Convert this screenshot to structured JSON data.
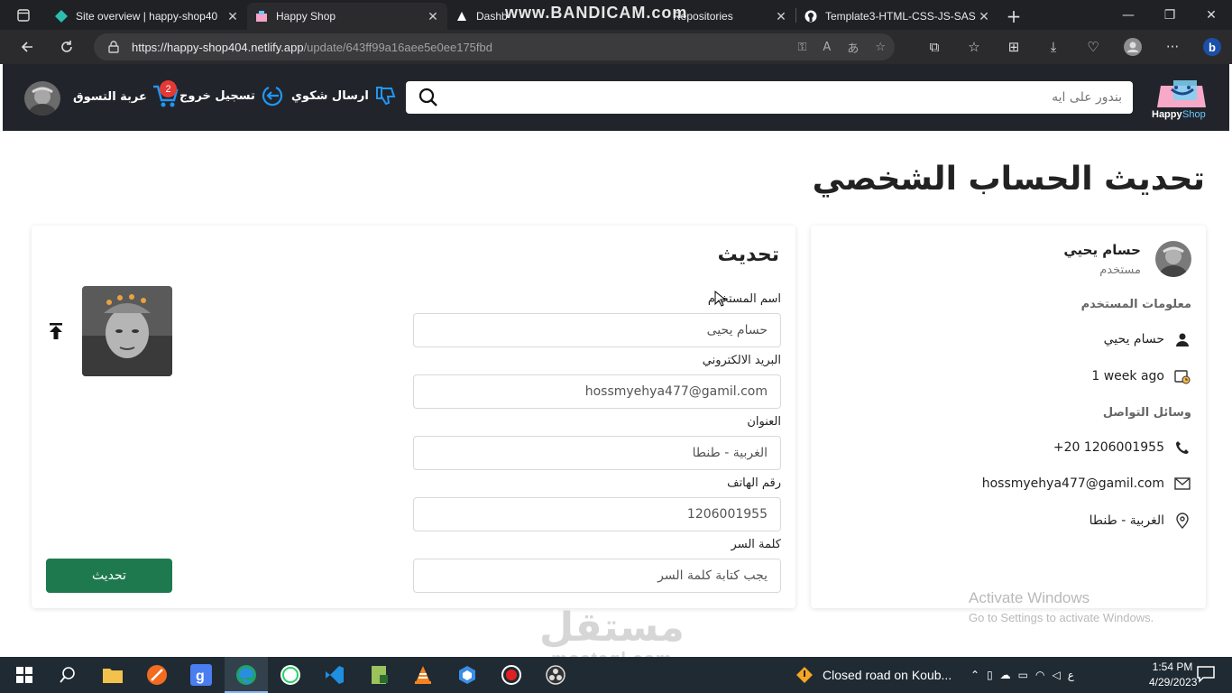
{
  "browser": {
    "tabs": [
      {
        "title": "Site overview | happy-shop40",
        "active": false
      },
      {
        "title": "Happy Shop",
        "active": true
      },
      {
        "title": "Dashb",
        "active": false
      },
      {
        "title": "Repositories",
        "active": false
      },
      {
        "title": "Template3-HTML-CSS-JS-SAS",
        "active": false
      }
    ],
    "recorder_watermark": "www.BANDICAM.com",
    "url_host": "https://happy-shop404.netlify.app",
    "url_path": "/update/643ff99a16aee5e0ee175fbd"
  },
  "navbar": {
    "logo_text_1": "Happy",
    "logo_text_2": "Shop",
    "search_placeholder": "بندور على ايه",
    "complaint_label": "ارسال شكوي",
    "logout_label": "تسجيل خروج",
    "cart_label": "عربة التسوق",
    "cart_count": "2"
  },
  "page": {
    "title": "تحديث الحساب الشخصي"
  },
  "profile": {
    "name": "حسام يحيي",
    "role": "مستخدم",
    "user_info_heading": "معلومات المستخدم",
    "username": "حسام يحيي",
    "joined": "1 week ago",
    "contact_heading": "وسائل التواصل",
    "phone": "+20 1206001955",
    "email": "hossmyehya477@gamil.com",
    "address": "الغربية - طنطا"
  },
  "form": {
    "title": "تحديث",
    "name_label": "اسم المستخدم",
    "name_value": "حسام يحيى",
    "email_label": "البريد الالكتروني",
    "email_value": "hossmyehya477@gamil.com",
    "address_label": "العنوان",
    "address_value": "الغربية - طنطا",
    "phone_label": "رقم الهاتف",
    "phone_value": "1206001955",
    "password_label": "كلمة السر",
    "password_placeholder": "يجب كتابة كلمة السر",
    "submit_label": "تحديث"
  },
  "overlay": {
    "activate_line1": "Activate Windows",
    "activate_line2": "Go to Settings to activate Windows.",
    "watermark_ar": "مستقل",
    "watermark_en": "mostaql.com"
  },
  "taskbar": {
    "notification": "Closed road on Koub...",
    "lang": "ع",
    "time": "1:54 PM",
    "date": "4/29/2023"
  },
  "colors": {
    "navbar_bg": "#21252b",
    "accent_blue": "#2196f3",
    "badge_red": "#e53935",
    "button_green": "#1e7a4e"
  }
}
